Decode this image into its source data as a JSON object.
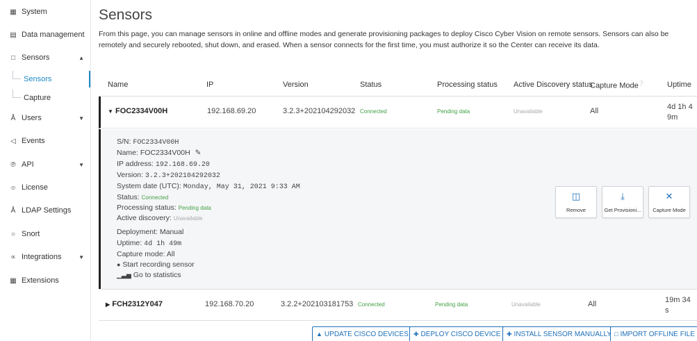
{
  "sidebar": {
    "items": [
      {
        "label": "System",
        "icon": "system-icon"
      },
      {
        "label": "Data management",
        "icon": "data-management-icon"
      },
      {
        "label": "Sensors",
        "icon": "sensors-icon"
      },
      {
        "label": "Users",
        "icon": "users-icon"
      },
      {
        "label": "Events",
        "icon": "events-icon"
      },
      {
        "label": "API",
        "icon": "api-icon"
      },
      {
        "label": "License",
        "icon": "license-icon"
      },
      {
        "label": "LDAP Settings",
        "icon": "ldap-icon"
      },
      {
        "label": "Snort",
        "icon": "snort-icon"
      },
      {
        "label": "Integrations",
        "icon": "integrations-icon"
      },
      {
        "label": "Extensions",
        "icon": "extensions-icon"
      }
    ],
    "sub_items": [
      {
        "label": "Sensors",
        "active": true
      },
      {
        "label": "Capture",
        "active": false
      }
    ]
  },
  "page": {
    "title": "Sensors",
    "intro": "From this page, you can manage sensors in online and offline modes and generate provisioning packages to deploy Cisco Cyber Vision on remote sensors. Sensors can also be remotely and securely rebooted, shut down, and erased. When a sensor connects for the first time, you must authorize it so the Center can receive its data."
  },
  "table": {
    "headers": [
      "Name",
      "IP",
      "Version",
      "Status",
      "Processing status",
      "Active Discovery status",
      "Capture Mode",
      "Uptime"
    ],
    "rows": [
      {
        "name": "FOC2334V00H",
        "ip": "192.168.69.20",
        "version": "3.2.3+202104292032",
        "status": "Connected",
        "processing": "Pending data",
        "discovery": "Unavailable",
        "capture": "All",
        "uptime_1": "4d 1h 4",
        "uptime_2": "9m"
      },
      {
        "name": "FCH2312Y047",
        "ip": "192.168.70.20",
        "version": "3.2.2+202103181753",
        "status": "Connected",
        "processing": "Pending data",
        "discovery": "Unavailable",
        "capture": "All",
        "uptime_1": "19m 34",
        "uptime_2": "s"
      }
    ]
  },
  "detail": {
    "sn_label": "S/N:",
    "sn_value": "FOC2334V00H",
    "name_label": "Name:",
    "name_value": "FOC2334V00H",
    "ip_label": "IP address:",
    "ip_value": "192.168.69.20",
    "version_label": "Version:",
    "version_value": "3.2.3+202104292032",
    "date_label": "System date (UTC):",
    "date_value": "Monday, May 31, 2021 9:33 AM",
    "status_label": "Status:",
    "status_value": "Connected",
    "processing_label": "Processing status:",
    "processing_value": "Pending data",
    "discovery_label": "Active discovery:",
    "discovery_value": "Unavailable",
    "deployment": "Deployment: Manual",
    "uptime_label": "Uptime:",
    "uptime_value": "4d 1h 49m",
    "capture": "Capture mode: All",
    "record_link": "Start recording sensor",
    "stats_link": "Go to statistics",
    "actions": [
      "Remove",
      "Get Provisioni...",
      "Capture Mode"
    ]
  },
  "footer": {
    "buttons": [
      "UPDATE CISCO DEVICES",
      "DEPLOY CISCO DEVICE",
      "INSTALL SENSOR MANUALLY",
      "IMPORT OFFLINE FILE"
    ]
  },
  "colors": {
    "accent": "#1e6fb8",
    "active_nav": "#1e88c8",
    "connected": "#43a047",
    "muted": "#aaaaaa"
  }
}
